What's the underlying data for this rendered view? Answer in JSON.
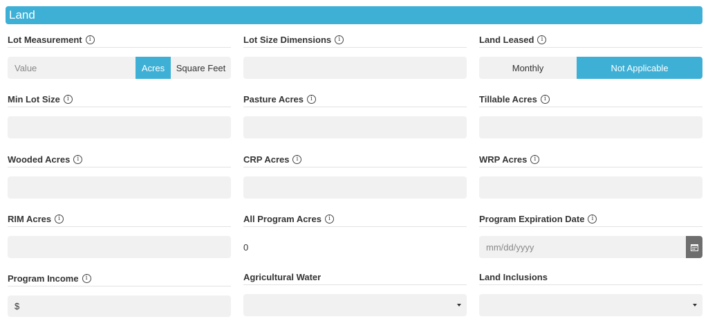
{
  "section": {
    "title": "Land"
  },
  "fields": {
    "lot_measurement": {
      "label": "Lot Measurement",
      "placeholder": "Value",
      "unit_options": [
        "Acres",
        "Square Feet"
      ],
      "selected_unit": "Acres"
    },
    "lot_size_dimensions": {
      "label": "Lot Size Dimensions",
      "value": ""
    },
    "land_leased": {
      "label": "Land Leased",
      "options": [
        "Monthly",
        "Not Applicable"
      ],
      "selected": "Not Applicable"
    },
    "min_lot_size": {
      "label": "Min Lot Size",
      "value": ""
    },
    "pasture_acres": {
      "label": "Pasture Acres",
      "value": ""
    },
    "tillable_acres": {
      "label": "Tillable Acres",
      "value": ""
    },
    "wooded_acres": {
      "label": "Wooded Acres",
      "value": ""
    },
    "crp_acres": {
      "label": "CRP Acres",
      "value": ""
    },
    "wrp_acres": {
      "label": "WRP Acres",
      "value": ""
    },
    "rim_acres": {
      "label": "RIM Acres",
      "value": ""
    },
    "all_program_acres": {
      "label": "All Program Acres",
      "value": "0"
    },
    "program_expiration_date": {
      "label": "Program Expiration Date",
      "placeholder": "mm/dd/yyyy"
    },
    "program_income": {
      "label": "Program Income",
      "value": "$"
    },
    "agricultural_water": {
      "label": "Agricultural Water",
      "value": ""
    },
    "land_inclusions": {
      "label": "Land Inclusions",
      "value": ""
    }
  },
  "icons": {
    "info": "info-circle-icon",
    "calendar": "calendar-icon",
    "dropdown": "caret-down-icon"
  },
  "colors": {
    "accent": "#3eb0d6",
    "input_bg": "#f1f1f1",
    "calendar_btn": "#6e6e6e"
  }
}
